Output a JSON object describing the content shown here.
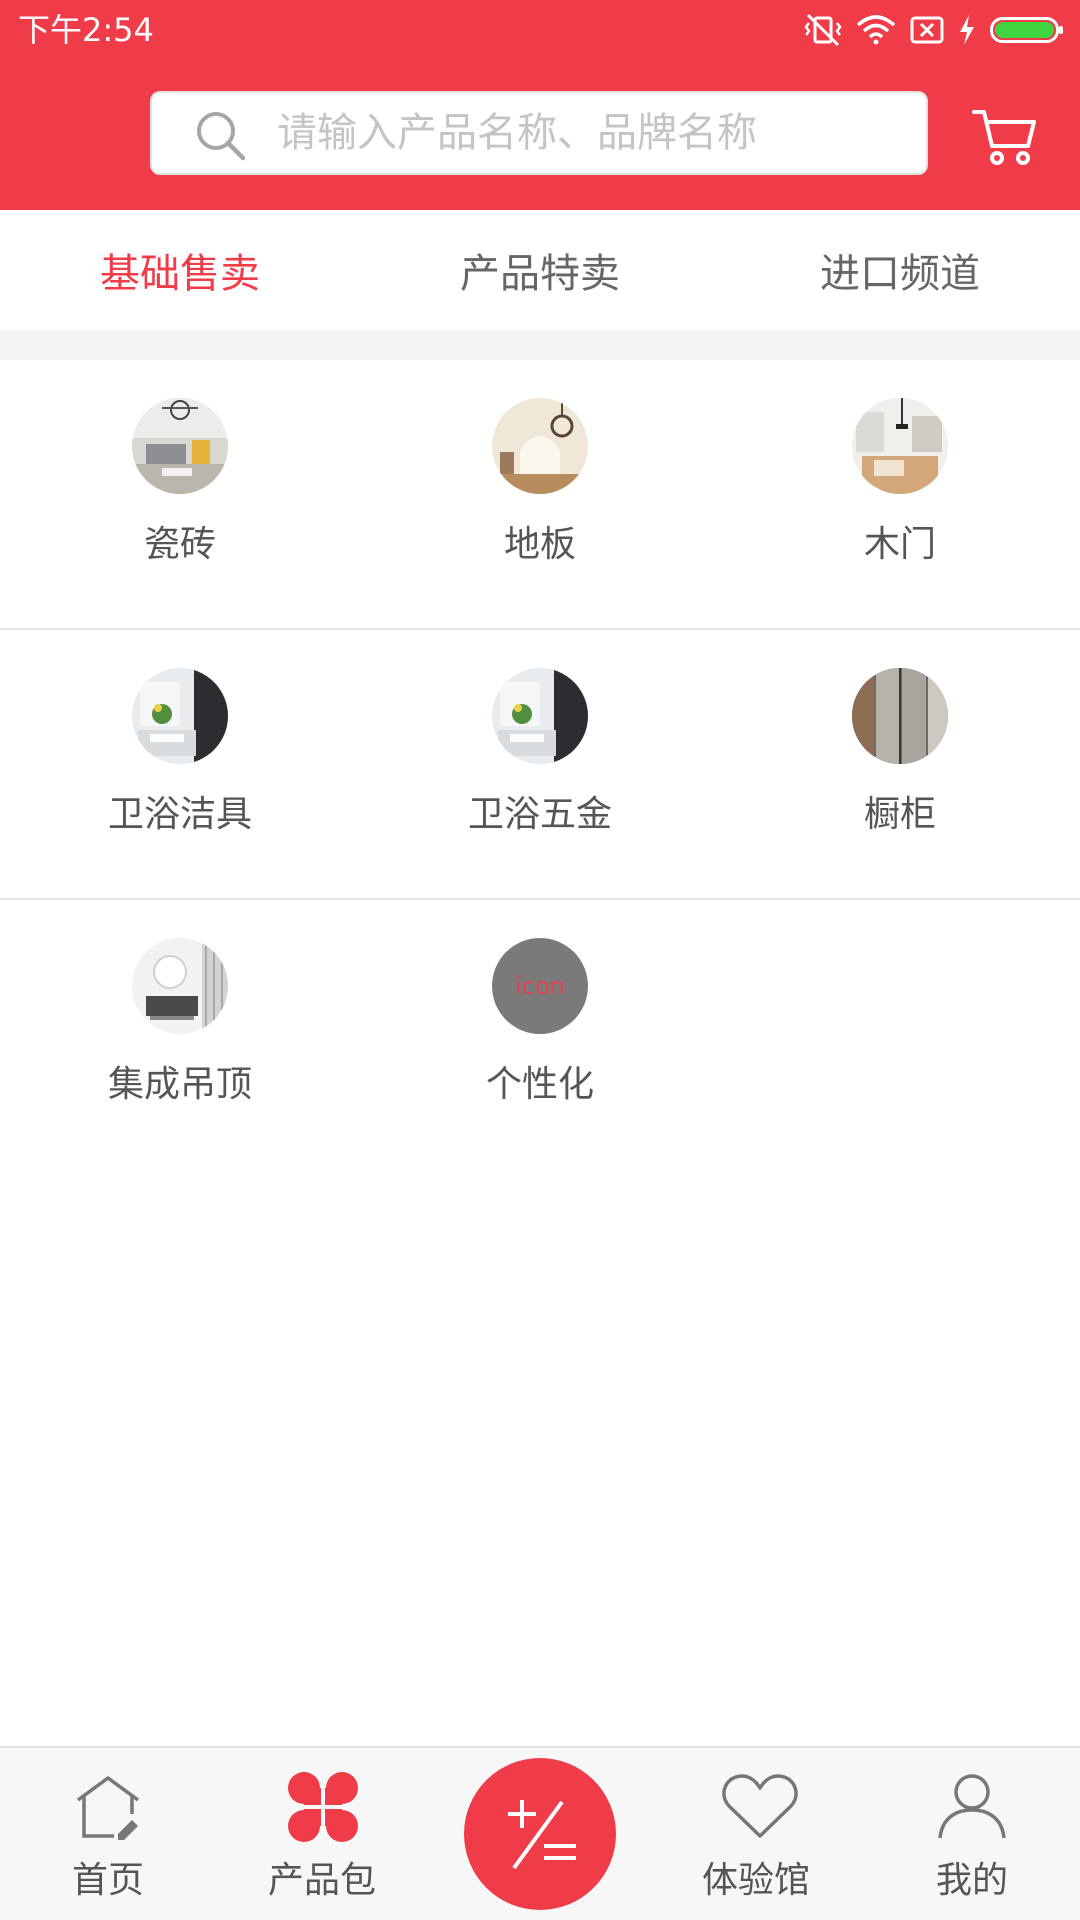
{
  "status_bar": {
    "time": "下午2:54"
  },
  "search": {
    "placeholder": "请输入产品名称、品牌名称",
    "value": ""
  },
  "tabs": [
    {
      "label": "基础售卖",
      "active": true
    },
    {
      "label": "产品特卖",
      "active": false
    },
    {
      "label": "进口频道",
      "active": false
    }
  ],
  "categories": [
    {
      "label": "瓷砖"
    },
    {
      "label": "地板"
    },
    {
      "label": "木门"
    },
    {
      "label": "卫浴洁具"
    },
    {
      "label": "卫浴五金"
    },
    {
      "label": "橱柜"
    },
    {
      "label": "集成吊顶"
    },
    {
      "label": "个性化",
      "placeholder_text": "icon"
    }
  ],
  "bottom_nav": {
    "items": [
      {
        "label": "首页"
      },
      {
        "label": "产品包"
      },
      {
        "label": "体验馆"
      },
      {
        "label": "我的"
      }
    ],
    "center_icon": "plus-minus-icon"
  },
  "colors": {
    "brand": "#f03c48",
    "tab_inactive": "#666666",
    "label_text": "#555555",
    "battery": "#3fd43f"
  }
}
